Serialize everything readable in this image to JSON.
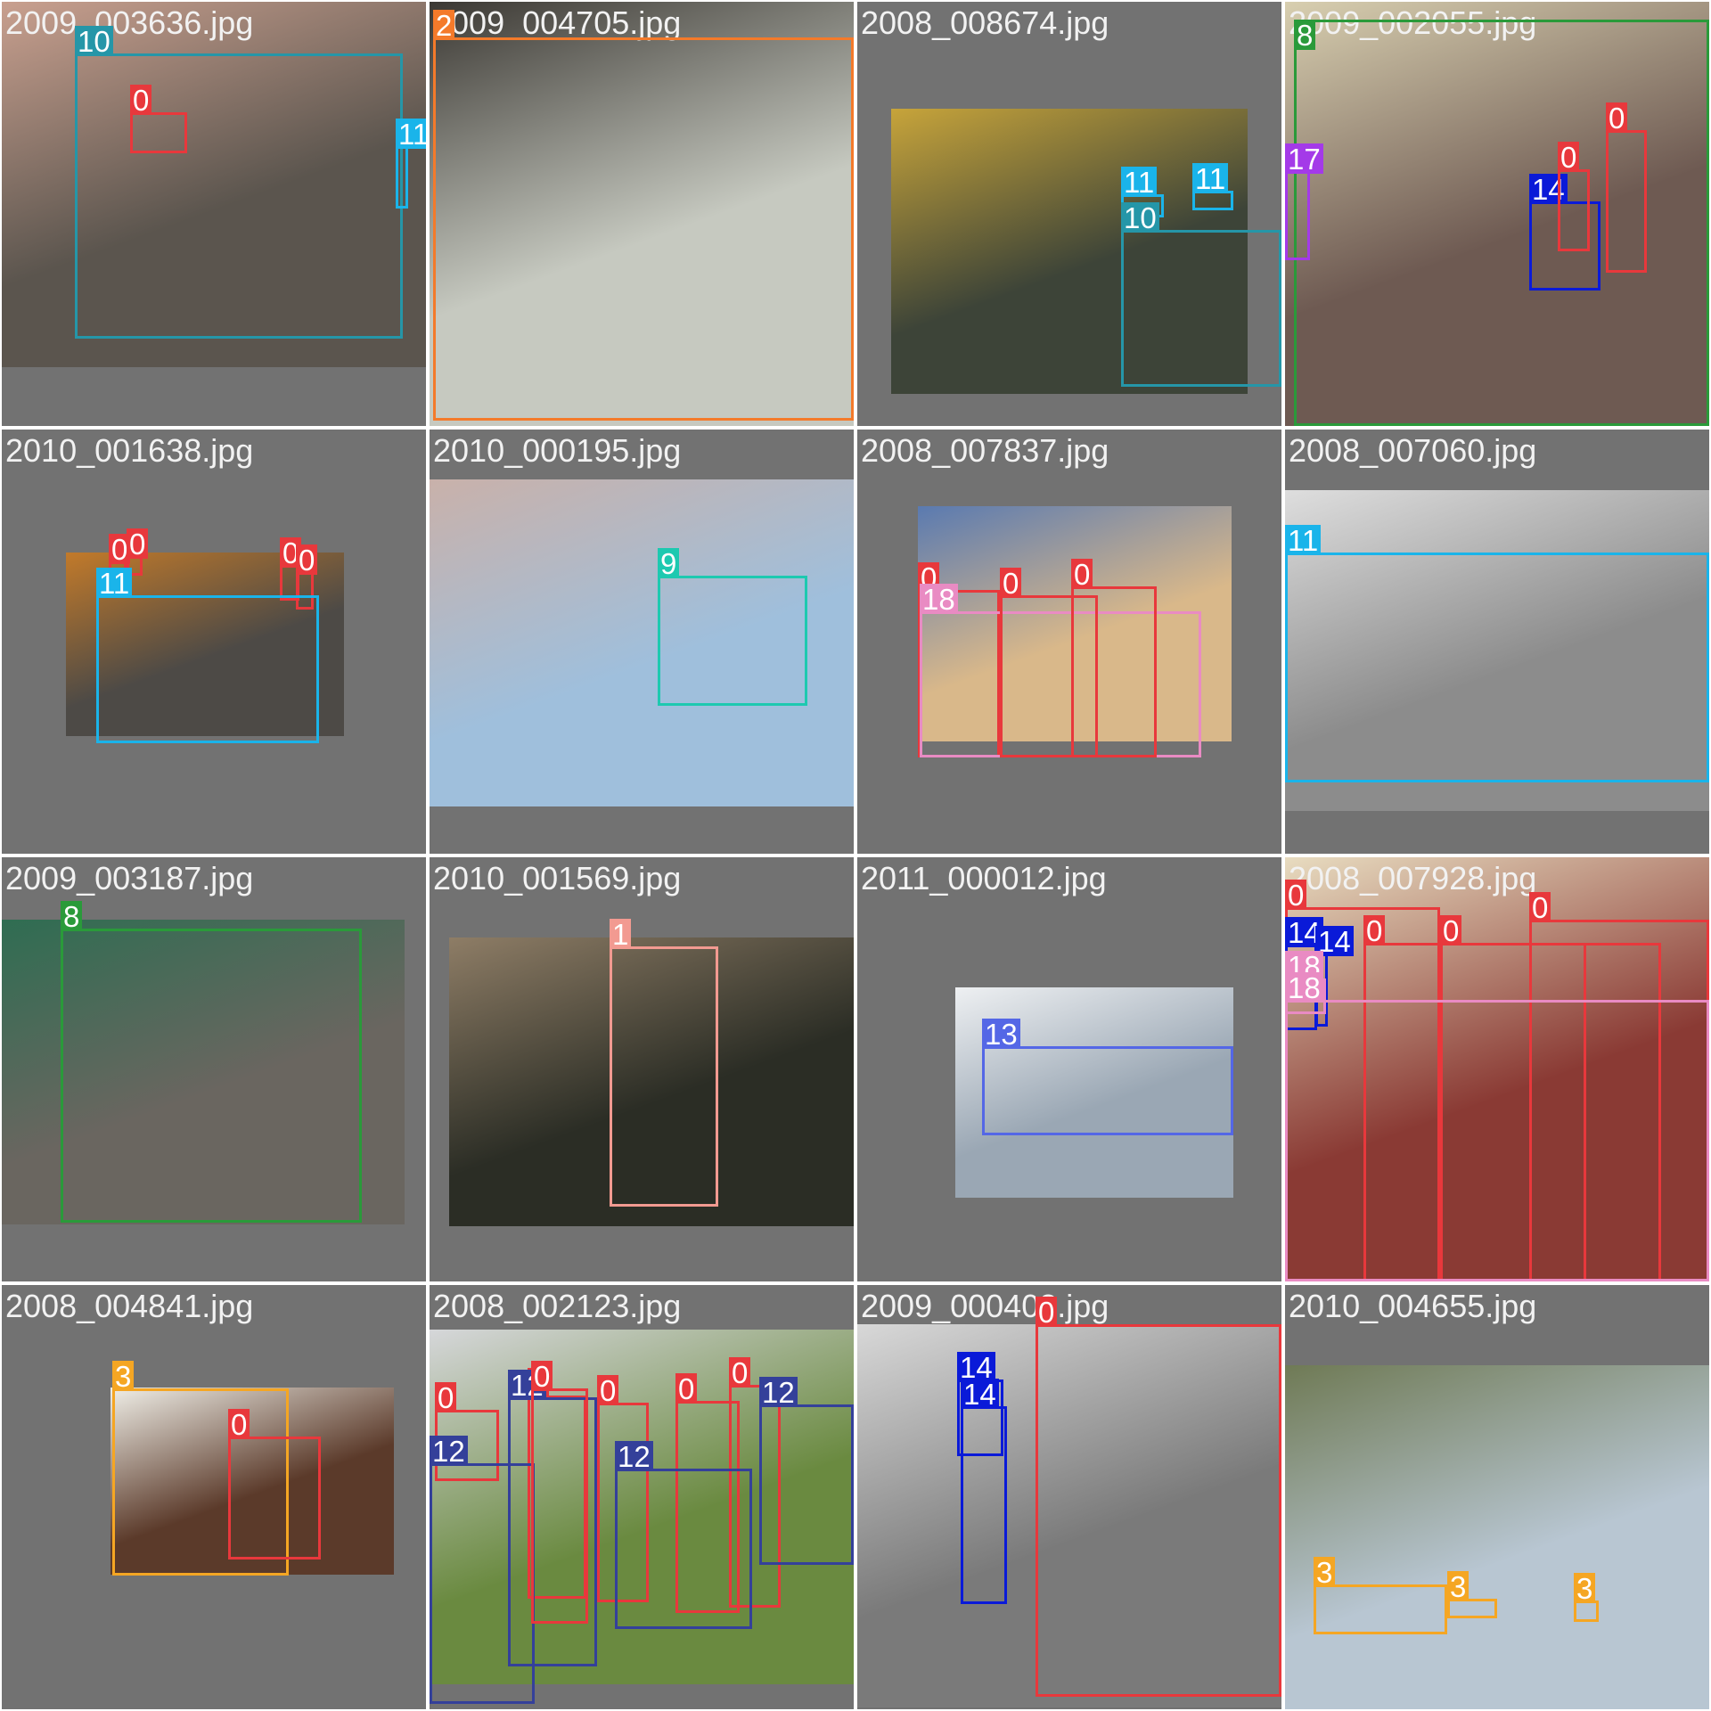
{
  "class_colors": {
    "0": "#e8383c",
    "1": "#f29a91",
    "2": "#f47a2a",
    "3": "#f5a623",
    "8": "#2a9a3a",
    "9": "#1dc9b0",
    "10": "#2596a8",
    "11": "#1ab4ea",
    "12": "#34409a",
    "13": "#5467e6",
    "14": "#0a1ad8",
    "17": "#a43ae8",
    "18": "#e98bc3"
  },
  "tiles": [
    {
      "label": "2009_003636.jpg",
      "photo_color": "#5b554e",
      "photo_shade": "#c9a08f",
      "boxes": [
        {
          "cls": "10"
        },
        {
          "cls": "0"
        },
        {
          "cls": "11"
        }
      ]
    },
    {
      "label": "2009_004705.jpg",
      "photo_color": "#c6c9c0",
      "photo_shade": "#3b3833",
      "boxes": [
        {
          "cls": "2"
        }
      ]
    },
    {
      "label": "2008_008674.jpg",
      "photo_color": "#3d4438",
      "photo_shade": "#c7a43a",
      "boxes": [
        {
          "cls": "11"
        },
        {
          "cls": "11"
        },
        {
          "cls": "10"
        }
      ]
    },
    {
      "label": "2009_002055.jpg",
      "photo_color": "#6e5a52",
      "photo_shade": "#d8cfb0",
      "boxes": [
        {
          "cls": "8"
        },
        {
          "cls": "0"
        },
        {
          "cls": "17"
        },
        {
          "cls": "14"
        },
        {
          "cls": "0"
        }
      ]
    },
    {
      "label": "2010_001638.jpg",
      "photo_color": "#4d4a46",
      "photo_shade": "#c27a2a",
      "boxes": [
        {
          "cls": "0"
        },
        {
          "cls": "0"
        },
        {
          "cls": "0"
        },
        {
          "cls": "0"
        },
        {
          "cls": "11"
        }
      ]
    },
    {
      "label": "2010_000195.jpg",
      "photo_color": "#9fbfdc",
      "photo_shade": "#c9b1aa",
      "boxes": [
        {
          "cls": "9"
        }
      ]
    },
    {
      "label": "2008_007837.jpg",
      "photo_color": "#d9b88a",
      "photo_shade": "#5a7ab0",
      "boxes": [
        {
          "cls": "0"
        },
        {
          "cls": "18"
        },
        {
          "cls": "0"
        },
        {
          "cls": "0"
        }
      ]
    },
    {
      "label": "2008_007060.jpg",
      "photo_color": "#8c8c8c",
      "photo_shade": "#dedede",
      "boxes": [
        {
          "cls": "11"
        }
      ]
    },
    {
      "label": "2009_003187.jpg",
      "photo_color": "#6a6660",
      "photo_shade": "#2f6d52",
      "boxes": [
        {
          "cls": "8"
        }
      ]
    },
    {
      "label": "2010_001569.jpg",
      "photo_color": "#2b2d25",
      "photo_shade": "#8e7d66",
      "boxes": [
        {
          "cls": "1"
        }
      ]
    },
    {
      "label": "2011_000012.jpg",
      "photo_color": "#9aa7b4",
      "photo_shade": "#eef0f2",
      "boxes": [
        {
          "cls": "13"
        }
      ]
    },
    {
      "label": "2008_007928.jpg",
      "photo_color": "#8a3a34",
      "photo_shade": "#e8dcc0",
      "boxes": [
        {
          "cls": "0"
        },
        {
          "cls": "0"
        },
        {
          "cls": "0"
        },
        {
          "cls": "14"
        },
        {
          "cls": "14"
        },
        {
          "cls": "18"
        },
        {
          "cls": "0"
        },
        {
          "cls": "18"
        }
      ]
    },
    {
      "label": "2008_004841.jpg",
      "photo_color": "#5b3a2a",
      "photo_shade": "#f0efe8",
      "boxes": [
        {
          "cls": "3"
        },
        {
          "cls": "0"
        }
      ]
    },
    {
      "label": "2008_002123.jpg",
      "photo_color": "#6a8a40",
      "photo_shade": "#d6d7da",
      "boxes": [
        {
          "cls": "0"
        },
        {
          "cls": "0"
        },
        {
          "cls": "0"
        },
        {
          "cls": "0"
        },
        {
          "cls": "0"
        },
        {
          "cls": "12"
        },
        {
          "cls": "12"
        },
        {
          "cls": "12"
        },
        {
          "cls": "12"
        },
        {
          "cls": "0"
        }
      ]
    },
    {
      "label": "2009_000408.jpg",
      "photo_color": "#7a7a7a",
      "photo_shade": "#d8d8d8",
      "boxes": [
        {
          "cls": "0"
        },
        {
          "cls": "14"
        },
        {
          "cls": "14"
        }
      ]
    },
    {
      "label": "2010_004655.jpg",
      "photo_color": "#b8c6d2",
      "photo_shade": "#6f7a55",
      "boxes": [
        {
          "cls": "3"
        },
        {
          "cls": "3"
        },
        {
          "cls": "3"
        }
      ]
    }
  ]
}
